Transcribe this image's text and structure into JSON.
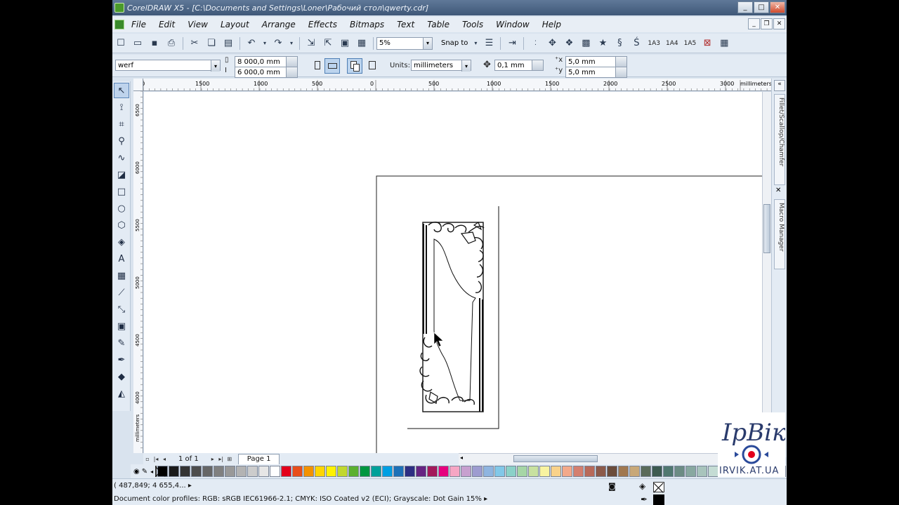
{
  "window": {
    "title": "CorelDRAW X5 - [C:\\Documents and Settings\\Loner\\Рабочий стол\\qwerty.cdr]",
    "min": "_",
    "max": "□",
    "close": "✕"
  },
  "menu": {
    "items": [
      "File",
      "Edit",
      "View",
      "Layout",
      "Arrange",
      "Effects",
      "Bitmaps",
      "Text",
      "Table",
      "Tools",
      "Window",
      "Help"
    ]
  },
  "toolbar": {
    "zoom_value": "5%",
    "snap_label": "Snap to",
    "label_1a3": "1A3",
    "label_1a4": "1A4",
    "label_1a5": "1A5"
  },
  "property_bar": {
    "preset_value": "werf",
    "width_value": "8 000,0 mm",
    "height_value": "6 000,0 mm",
    "units_label": "Units:",
    "units_value": "millimeters",
    "nudge_value": "0,1 mm",
    "dup_x_value": "5,0 mm",
    "dup_y_value": "5,0 mm"
  },
  "rulers": {
    "h_labels": [
      "00",
      "1500",
      "1000",
      "500",
      "0",
      "500",
      "1000",
      "1500",
      "2000",
      "2500",
      "3000",
      "millimeters"
    ],
    "v_labels": [
      "6500",
      "6000",
      "5500",
      "5000",
      "4500",
      "4000",
      "millimeters"
    ]
  },
  "dockers": {
    "tab1": "Fillet/Scallop/Chamfer",
    "tab2": "Macro Manager"
  },
  "page_nav": {
    "counter": "1 of 1",
    "page_tab": "Page 1"
  },
  "palette": {
    "colors": [
      "#000000",
      "#1a1a1a",
      "#333333",
      "#4d4d4d",
      "#666666",
      "#808080",
      "#999999",
      "#b3b3b3",
      "#cccccc",
      "#e6e6e6",
      "#ffffff",
      "#e3001b",
      "#e84e1b",
      "#f39200",
      "#ffd500",
      "#fff200",
      "#c1d82f",
      "#5bb030",
      "#009640",
      "#00a19a",
      "#009fe3",
      "#1d71b8",
      "#2d2e83",
      "#662483",
      "#a3195b",
      "#e6007e",
      "#f6a6c4",
      "#c7a0cf",
      "#9d9cd0",
      "#8fb5e0",
      "#82c8e8",
      "#8bd1c8",
      "#a6d6a6",
      "#c8e1a0",
      "#f8f3a0",
      "#f9d28a",
      "#f3a98a",
      "#d47f6f",
      "#b86a5a",
      "#8c5a4a",
      "#6b4c3b",
      "#a07850",
      "#c8a878",
      "#5a6b5a",
      "#3c5a50",
      "#507870",
      "#6c8c84",
      "#88a8a0",
      "#a8c4bc",
      "#c4dcd4",
      "#6a8aa0",
      "#4c6c8c",
      "#2c4c6c",
      "#1c2c4c",
      "#b0c0d0",
      "#d8e0e8",
      "#f0f4f8",
      "#c0e0c0",
      "#a0d0a0",
      "#e0f0e0"
    ]
  },
  "status": {
    "coords": "( 487,849; 4 655,4... ▸",
    "profiles": "Document color profiles: RGB: sRGB IEC61966-2.1; CMYK: ISO Coated v2 (ECI); Grayscale: Dot Gain 15% ▸"
  },
  "watermark": {
    "brand": "ІрВік",
    "site": "IRVIK.AT.UA"
  }
}
